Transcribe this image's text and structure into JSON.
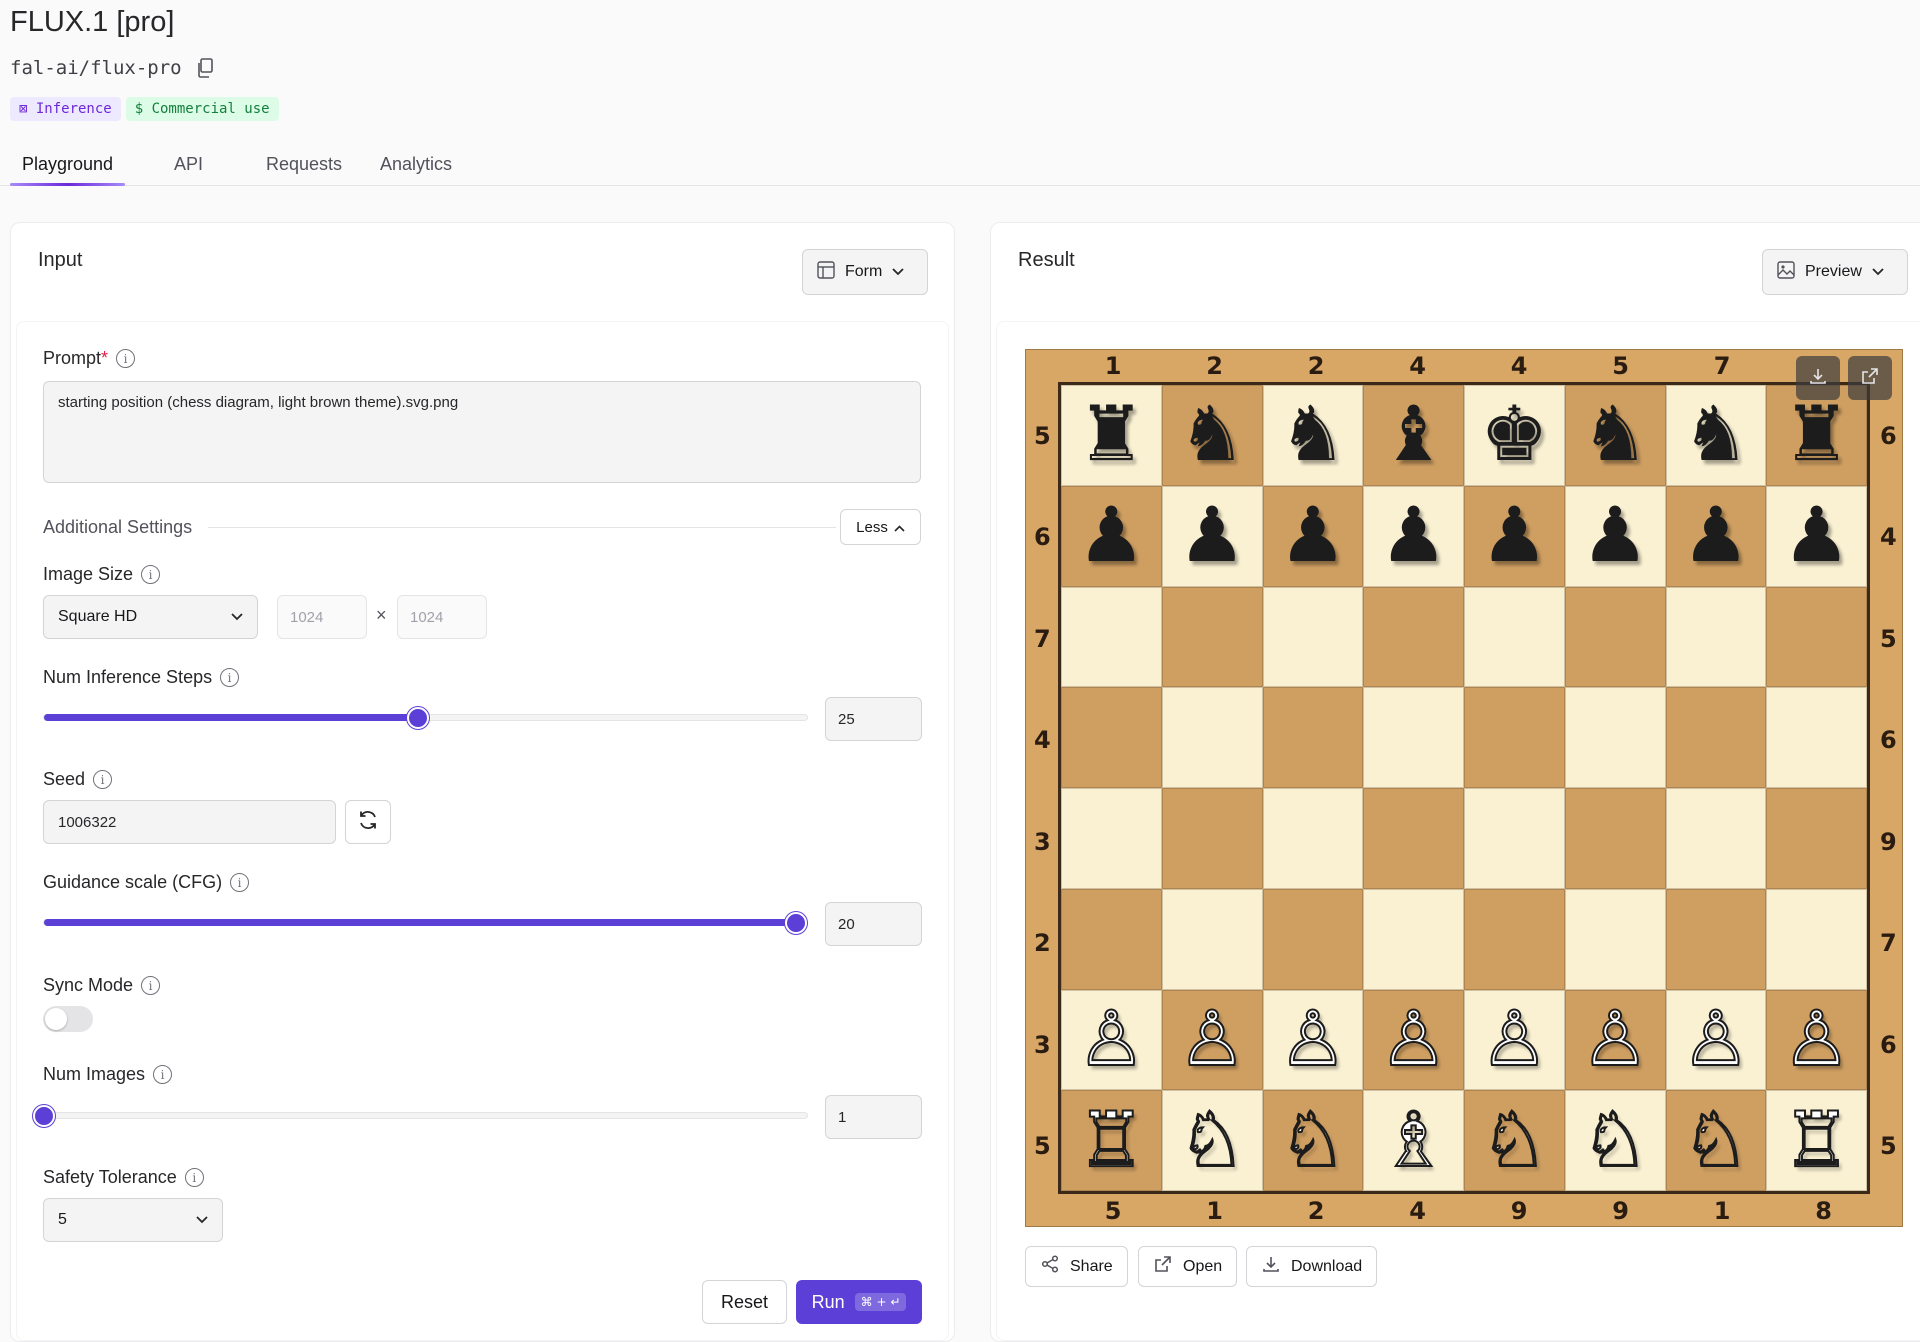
{
  "header": {
    "title": "FLUX.1 [pro]",
    "model_id": "fal-ai/flux-pro",
    "badges": {
      "inference": "Inference",
      "commercial": "$ Commercial use"
    }
  },
  "tabs": [
    "Playground",
    "API",
    "Requests",
    "Analytics"
  ],
  "input_panel": {
    "title": "Input",
    "mode_button": "Form",
    "prompt": {
      "label": "Prompt",
      "required_mark": "*",
      "value": "starting position (chess diagram, light brown theme).svg.png"
    },
    "additional_settings": {
      "label": "Additional Settings",
      "toggle_label": "Less"
    },
    "image_size": {
      "label": "Image Size",
      "selected": "Square HD",
      "width": "1024",
      "height": "1024",
      "times": "×"
    },
    "num_inference_steps": {
      "label": "Num Inference Steps",
      "value": "25",
      "fraction": 0.49
    },
    "seed": {
      "label": "Seed",
      "value": "1006322"
    },
    "guidance_scale": {
      "label": "Guidance scale (CFG)",
      "value": "20",
      "fraction": 0.985
    },
    "sync_mode": {
      "label": "Sync Mode",
      "enabled": false
    },
    "num_images": {
      "label": "Num Images",
      "value": "1",
      "fraction": 0.0
    },
    "safety_tolerance": {
      "label": "Safety Tolerance",
      "selected": "5"
    },
    "buttons": {
      "reset": "Reset",
      "run": "Run",
      "run_shortcut": "⌘ + ↵"
    }
  },
  "result_panel": {
    "title": "Result",
    "mode_button": "Preview",
    "board": {
      "top_labels": [
        "1",
        "2",
        "2",
        "4",
        "4",
        "5",
        "7",
        ""
      ],
      "bottom_labels": [
        "5",
        "1",
        "2",
        "4",
        "9",
        "9",
        "1",
        "8"
      ],
      "left_labels": [
        "5",
        "6",
        "7",
        "4",
        "3",
        "2",
        "3",
        "5"
      ],
      "right_labels": [
        "6",
        "4",
        "5",
        "6",
        "9",
        "7",
        "6",
        "5"
      ],
      "ranks": [
        [
          "♜",
          "♞",
          "♞",
          "♝",
          "♚",
          "♞",
          "♞",
          "♜"
        ],
        [
          "♟",
          "♟",
          "♟",
          "♟",
          "♟",
          "♟",
          "♟",
          "♟"
        ],
        [
          "",
          "",
          "",
          "",
          "",
          "",
          "",
          ""
        ],
        [
          "",
          "",
          "",
          "",
          "",
          "",
          "",
          ""
        ],
        [
          "",
          "",
          "",
          "",
          "",
          "",
          "",
          ""
        ],
        [
          "",
          "",
          "",
          "",
          "",
          "",
          "",
          ""
        ],
        [
          "♙",
          "♙",
          "♙",
          "♙",
          "♙",
          "♙",
          "♙",
          "♙"
        ],
        [
          "♖",
          "♘",
          "♘",
          "♗",
          "♘",
          "♘",
          "♘",
          "♖"
        ]
      ]
    },
    "actions": {
      "share": "Share",
      "open": "Open",
      "download": "Download"
    }
  }
}
